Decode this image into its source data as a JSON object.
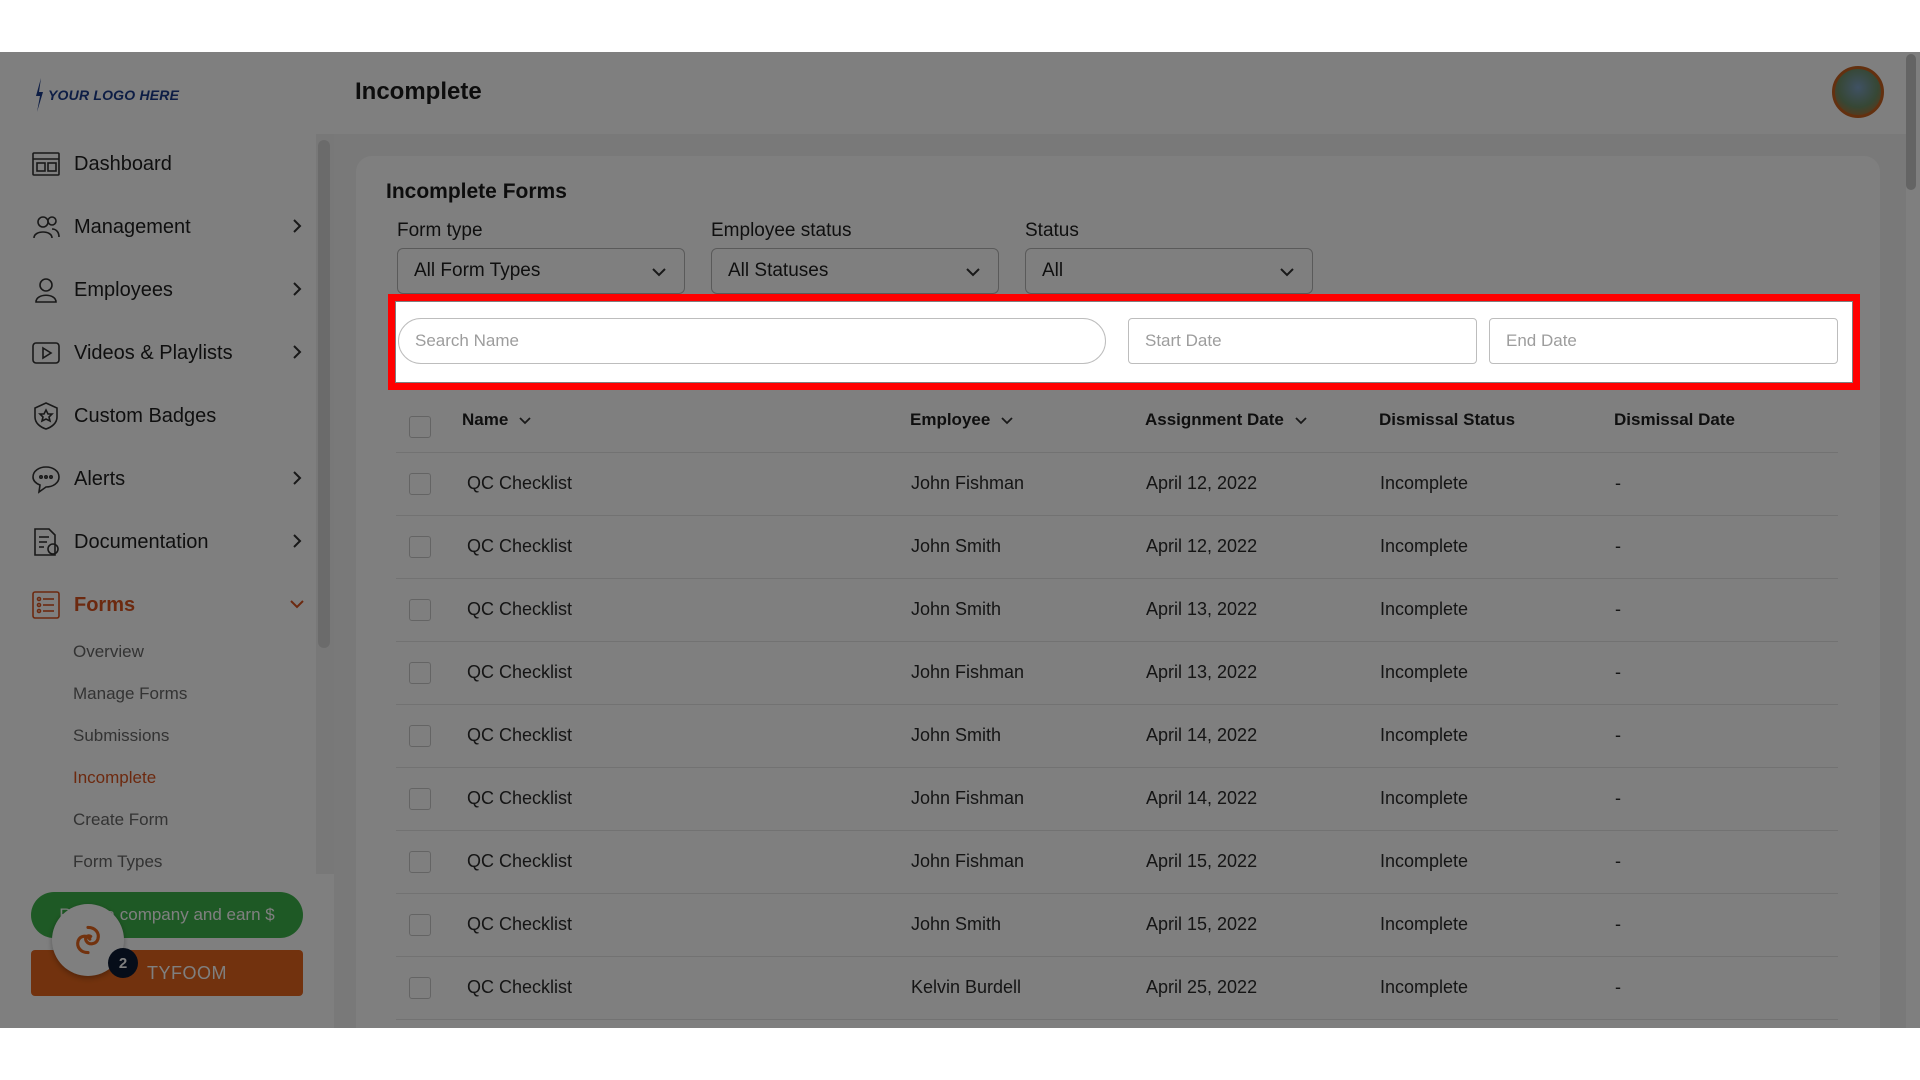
{
  "logo": {
    "text": "YOUR LOGO HERE"
  },
  "header": {
    "title": "Incomplete"
  },
  "sidebar": {
    "items": [
      {
        "label": "Dashboard",
        "icon": "dashboard-icon"
      },
      {
        "label": "Management",
        "icon": "management-icon"
      },
      {
        "label": "Employees",
        "icon": "employees-icon"
      },
      {
        "label": "Videos & Playlists",
        "icon": "video-icon"
      },
      {
        "label": "Custom Badges",
        "icon": "badge-icon"
      },
      {
        "label": "Alerts",
        "icon": "alerts-icon"
      },
      {
        "label": "Documentation",
        "icon": "documentation-icon"
      },
      {
        "label": "Forms",
        "icon": "forms-icon"
      }
    ],
    "forms_sub": [
      "Overview",
      "Manage Forms",
      "Submissions",
      "Incomplete",
      "Create Form",
      "Form Types"
    ],
    "active_sub": "Incomplete",
    "refer_label": "Refer a company and earn $",
    "tyfoom_label": "TYFOOM",
    "notification_count": "2"
  },
  "panel": {
    "title": "Incomplete Forms",
    "filters": {
      "form_type_label": "Form type",
      "form_type_value": "All Form Types",
      "employee_status_label": "Employee status",
      "employee_status_value": "All Statuses",
      "status_label": "Status",
      "status_value": "All"
    },
    "search": {
      "name_placeholder": "Search Name",
      "start_placeholder": "Start Date",
      "end_placeholder": "End Date"
    },
    "table": {
      "columns": [
        "Name",
        "Employee",
        "Assignment Date",
        "Dismissal Status",
        "Dismissal Date"
      ],
      "rows": [
        {
          "name": "QC Checklist",
          "employee": "John Fishman",
          "date": "April 12, 2022",
          "status": "Incomplete",
          "dismissal": "-"
        },
        {
          "name": "QC Checklist",
          "employee": "John Smith",
          "date": "April 12, 2022",
          "status": "Incomplete",
          "dismissal": "-"
        },
        {
          "name": "QC Checklist",
          "employee": "John Smith",
          "date": "April 13, 2022",
          "status": "Incomplete",
          "dismissal": "-"
        },
        {
          "name": "QC Checklist",
          "employee": "John Fishman",
          "date": "April 13, 2022",
          "status": "Incomplete",
          "dismissal": "-"
        },
        {
          "name": "QC Checklist",
          "employee": "John Smith",
          "date": "April 14, 2022",
          "status": "Incomplete",
          "dismissal": "-"
        },
        {
          "name": "QC Checklist",
          "employee": "John Fishman",
          "date": "April 14, 2022",
          "status": "Incomplete",
          "dismissal": "-"
        },
        {
          "name": "QC Checklist",
          "employee": "John Fishman",
          "date": "April 15, 2022",
          "status": "Incomplete",
          "dismissal": "-"
        },
        {
          "name": "QC Checklist",
          "employee": "John Smith",
          "date": "April 15, 2022",
          "status": "Incomplete",
          "dismissal": "-"
        },
        {
          "name": "QC Checklist",
          "employee": "Kelvin Burdell",
          "date": "April 25, 2022",
          "status": "Incomplete",
          "dismissal": "-"
        }
      ]
    }
  },
  "colors": {
    "accent": "#d9531e",
    "refer": "#3db34a",
    "tyfoom": "#e4651c",
    "highlight": "#ff0000"
  }
}
